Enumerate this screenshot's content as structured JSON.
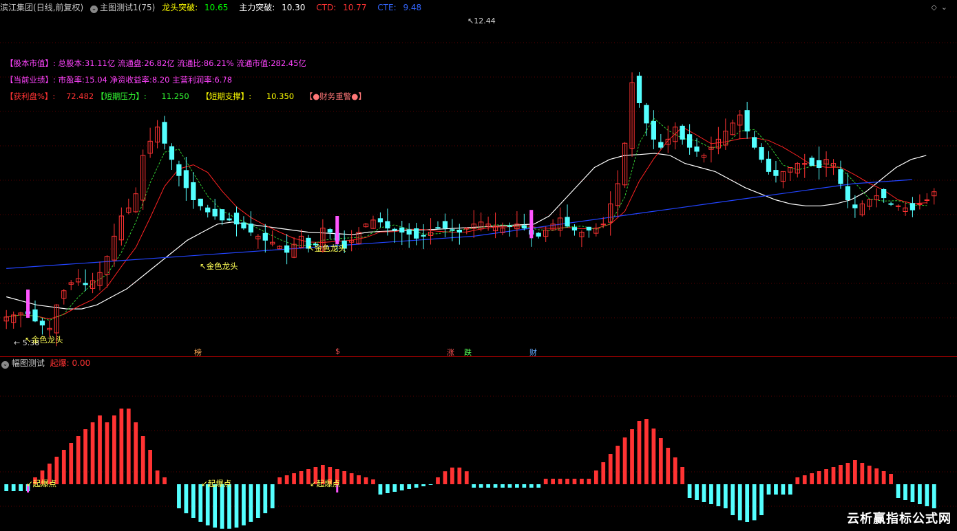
{
  "header": {
    "stock_name": "滨江集团",
    "period": "(日线,前复权)",
    "indicator_name": "主图测试1(75)",
    "items": [
      {
        "label": "龙头突破:",
        "value": "10.65",
        "color": "#ffff00"
      },
      {
        "label": "主力突破:",
        "value": "10.30",
        "color": "#ffffff"
      },
      {
        "label": "CTD:",
        "value": "10.77",
        "color": "#ff3333"
      },
      {
        "label": "CTE:",
        "value": "9.48",
        "color": "#3366ff"
      }
    ]
  },
  "info": {
    "line1": {
      "tag": "【股本市值】:",
      "text": "总股本:31.11亿 流通盘:26.82亿 流通比:86.21% 流通市值:282.45亿"
    },
    "line2": {
      "tag": "【当前业绩】:",
      "text": "市盈率:15.04 净资收益率:8.20 主营利润率:6.78"
    },
    "line3": {
      "profit_label": "【获利盘%】:",
      "profit_value": "72.482",
      "pressure_label": "【短期压力】:",
      "pressure_value": "11.250",
      "support_label": "【短期支撑】:",
      "support_value": "10.350",
      "warning": "【●财务重警●】"
    }
  },
  "price_labels": {
    "high": "12.44",
    "low": "5.38"
  },
  "signals": {
    "golden_dragon": "金色龙头",
    "explosion": "起爆点"
  },
  "event_markers": [
    {
      "text": "榜",
      "color": "#ffaa55"
    },
    {
      "text": "$",
      "color": "#ff5555"
    },
    {
      "text": "涨",
      "color": "#ff5555"
    },
    {
      "text": "跌",
      "color": "#55ff55"
    },
    {
      "text": "财",
      "color": "#66aaff"
    }
  ],
  "subchart": {
    "title": "幅图测试",
    "label": "起爆:",
    "value": "0.00"
  },
  "watermark": "云析赢指标公式网",
  "colors": {
    "up": "#ff3333",
    "down": "#54ffff",
    "ma_white": "#ffffff",
    "ma_red": "#ff2222",
    "ma_green": "#33cc33",
    "ma_blue": "#2244ff",
    "magenta": "#ff55ff"
  },
  "chart_data": {
    "type": "candlestick",
    "candle_count": 130,
    "y_range": [
      5.0,
      13.0
    ],
    "close": [
      5.7,
      5.75,
      5.8,
      5.78,
      5.6,
      5.5,
      5.42,
      6.0,
      6.35,
      6.55,
      6.65,
      6.5,
      6.6,
      6.8,
      7.2,
      7.7,
      8.2,
      8.4,
      8.75,
      9.7,
      10.05,
      10.4,
      10.0,
      9.6,
      9.2,
      8.9,
      8.6,
      8.45,
      8.3,
      8.2,
      8.1,
      8.1,
      8.0,
      7.9,
      7.8,
      7.7,
      7.6,
      7.55,
      7.45,
      7.3,
      7.5,
      7.7,
      7.4,
      7.5,
      7.9,
      7.8,
      7.6,
      7.4,
      7.6,
      7.8,
      8.0,
      8.1,
      8.05,
      7.9,
      7.85,
      7.8,
      7.75,
      7.65,
      7.7,
      7.8,
      7.9,
      7.9,
      7.85,
      7.8,
      7.9,
      8.0,
      8.05,
      8.0,
      7.95,
      7.9,
      7.95,
      8.0,
      7.9,
      7.75,
      7.7,
      7.85,
      8.0,
      8.15,
      7.95,
      7.85,
      7.8,
      7.85,
      7.9,
      8.0,
      8.5,
      9.0,
      10.0,
      11.5,
      11.0,
      10.5,
      10.1,
      9.9,
      10.1,
      10.4,
      10.1,
      9.9,
      9.8,
      9.7,
      9.9,
      10.1,
      10.3,
      10.5,
      10.7,
      10.3,
      9.9,
      9.6,
      9.3,
      9.2,
      9.3,
      9.4,
      9.5,
      9.5,
      9.45,
      9.4,
      9.6,
      9.5,
      9.0,
      8.6,
      8.4,
      8.5,
      8.6,
      8.7,
      8.65,
      8.5,
      8.45,
      8.4,
      8.35,
      8.5,
      8.6,
      8.8
    ],
    "ma_white": [
      6.2,
      6.1,
      6.0,
      5.95,
      5.9,
      5.9,
      6.0,
      6.2,
      6.4,
      6.7,
      7.0,
      7.3,
      7.6,
      7.8,
      8.0,
      8.05,
      8.0,
      7.95,
      7.9,
      7.85,
      7.8,
      7.78,
      7.76,
      7.74,
      7.8,
      7.82,
      7.84,
      7.85,
      7.86,
      7.88,
      7.9,
      7.92,
      7.94,
      7.96,
      7.98,
      8.0,
      8.2,
      8.6,
      9.0,
      9.4,
      9.6,
      9.7,
      9.72,
      9.75,
      9.7,
      9.5,
      9.4,
      9.3,
      9.1,
      8.9,
      8.75,
      8.6,
      8.5,
      8.45,
      8.45,
      8.5,
      8.6,
      8.8,
      9.1,
      9.4,
      9.6,
      9.7
    ],
    "ma_blue": [
      6.9,
      6.95,
      7.0,
      7.05,
      7.1,
      7.15,
      7.2,
      7.25,
      7.3,
      7.35,
      7.4,
      7.45,
      7.5,
      7.55,
      7.6,
      7.65,
      7.7,
      7.8,
      7.9,
      8.0,
      8.1,
      8.2,
      8.3,
      8.4,
      8.5,
      8.6,
      8.7,
      8.8,
      8.9,
      9.0,
      9.05,
      9.1
    ]
  }
}
